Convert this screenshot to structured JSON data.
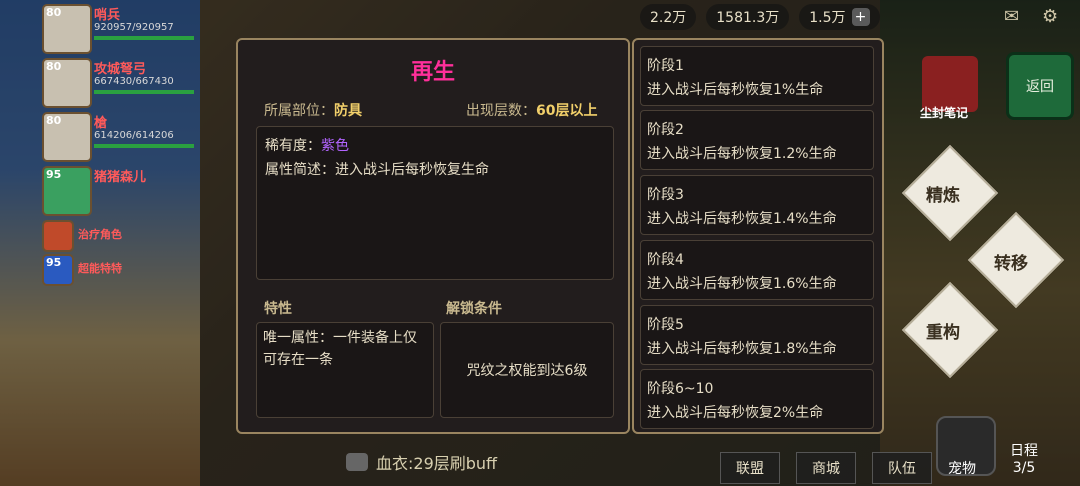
{
  "topbar": {
    "resource1": "2.2万",
    "resource2": "1581.3万",
    "resource3": "1.5万"
  },
  "party": [
    {
      "level": "80",
      "name": "哨兵",
      "hp": "920957/920957"
    },
    {
      "level": "80",
      "name": "攻城弩弓",
      "hp": "667430/667430"
    },
    {
      "level": "80",
      "name": "槍",
      "hp": "614206/614206"
    },
    {
      "level": "95",
      "name": "猪猪森儿"
    },
    {
      "level": "",
      "name": "治疗角色"
    },
    {
      "level": "95",
      "name": "超能特特"
    }
  ],
  "side_buttons": {
    "back": "返回",
    "seal": "尘封笔记",
    "refine": "精炼",
    "transfer": "转移",
    "rebuild": "重构"
  },
  "bottom": {
    "chat": "血衣:29层刷buff",
    "alliance": "联盟",
    "shop": "商城",
    "team": "队伍",
    "pet": "宠物",
    "schedule": "日程",
    "schedule_count": "3/5"
  },
  "modal": {
    "title": "再生",
    "part_label": "所属部位：",
    "part_value": "防具",
    "floor_label": "出现层数：",
    "floor_value": "60层以上",
    "rarity_label": "稀有度：",
    "rarity_value": "紫色",
    "desc": "属性简述：进入战斗后每秒恢复生命",
    "trait_label": "特性",
    "trait_text": "唯一属性：一件装备上仅可存在一条",
    "unlock_label": "解锁条件",
    "unlock_text": "咒纹之权能到达6级",
    "stages": [
      {
        "name": "阶段1",
        "desc": "进入战斗后每秒恢复1%生命"
      },
      {
        "name": "阶段2",
        "desc": "进入战斗后每秒恢复1.2%生命"
      },
      {
        "name": "阶段3",
        "desc": "进入战斗后每秒恢复1.4%生命"
      },
      {
        "name": "阶段4",
        "desc": "进入战斗后每秒恢复1.6%生命"
      },
      {
        "name": "阶段5",
        "desc": "进入战斗后每秒恢复1.8%生命"
      },
      {
        "name": "阶段6~10",
        "desc": "进入战斗后每秒恢复2%生命"
      }
    ]
  },
  "colors": {
    "title": "#ff2f9a",
    "rarity": "#b264ff",
    "meta_value": "#f1cf6a",
    "border": "#9a8560"
  }
}
